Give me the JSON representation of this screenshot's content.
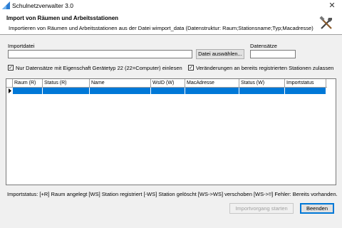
{
  "window": {
    "title": "Schulnetzverwalter 3.0",
    "app_icon": "app-icon",
    "close_glyph": "✕"
  },
  "header": {
    "title": "Import von Räumen und Arbeitsstationen",
    "subtitle": "Importieren von Räumen und Arbeitsstationen aus der Datei wimport_data (Datenstruktur: Raum;Stationsname;Typ;Macadresse)",
    "icon": "tools-icon"
  },
  "form": {
    "import_label": "Importdatei",
    "import_value": "",
    "choose_file_label": "Datei auswählen...",
    "records_label": "Datensätze",
    "records_value": "",
    "check1_label": "Nur Datensätze mit Eigenschaft Gerätetyp 22 (22=Computer) einlesen",
    "check1_checked": true,
    "check2_label": "Veränderungen an bereits registrierten Stationen zulassen",
    "check2_checked": true
  },
  "grid": {
    "columns": [
      "Raum (R)",
      "Status (R)",
      "Name",
      "WsID (W)",
      "MacAdresse",
      "Status (W)",
      "Importstatus"
    ],
    "rows": [
      [
        "",
        "",
        "",
        "",
        "",
        "",
        ""
      ]
    ],
    "selected_row": 0
  },
  "status_text": "Importstatus: [+R] Raum angelegt  [WS] Station registriert  [-WS] Station gelöscht  [WS->WS] verschoben  [WS->!!] Fehler: Bereits vorhanden.",
  "buttons": {
    "start": "Importvorgang starten",
    "end": "Beenden"
  }
}
